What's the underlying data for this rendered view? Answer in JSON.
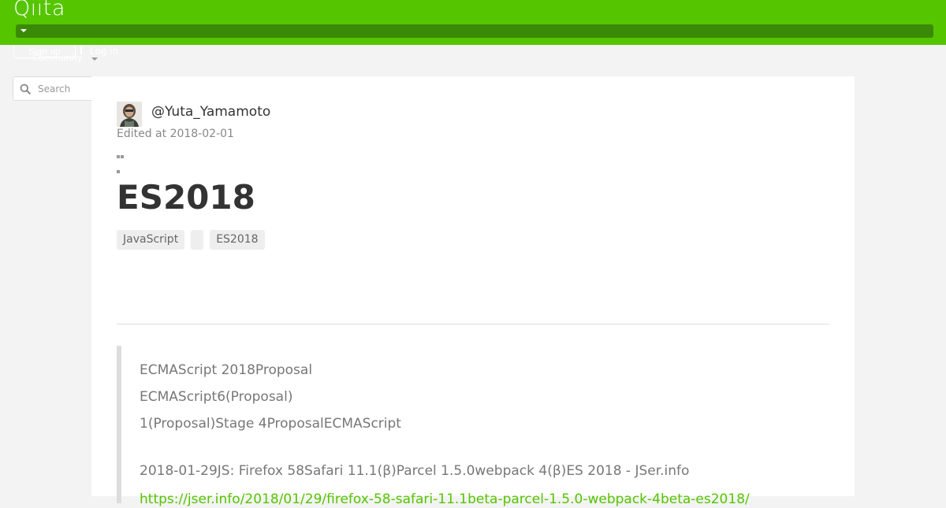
{
  "header": {
    "logo_text": "Qiita",
    "community_label": "Community",
    "signup_label": "Sign up",
    "login_label": "Log in",
    "brand_color": "#55c500"
  },
  "search": {
    "placeholder": "Search",
    "value": ""
  },
  "article": {
    "author_handle": "@Yuta_Yamamoto",
    "edited_at": "Edited at 2018-02-01",
    "title": "ES2018",
    "tags": [
      "JavaScript",
      "",
      "ES2018"
    ],
    "blockquote": {
      "lines": [
        "ECMAScript 2018Proposal",
        "ECMAScript6(Proposal)",
        "1(Proposal)Stage 4ProposalECMAScript"
      ],
      "news": "2018-01-29JS: Firefox 58Safari 11.1(β)Parcel 1.5.0webpack 4(β)ES 2018 - JSer.info",
      "link_text": "https://jser.info/2018/01/29/firefox-58-safari-11.1beta-parcel-1.5.0-webpack-4beta-es2018/"
    }
  },
  "icons": {
    "search": "search-icon",
    "more": "more-icon",
    "caret": "chevron-down-icon"
  }
}
